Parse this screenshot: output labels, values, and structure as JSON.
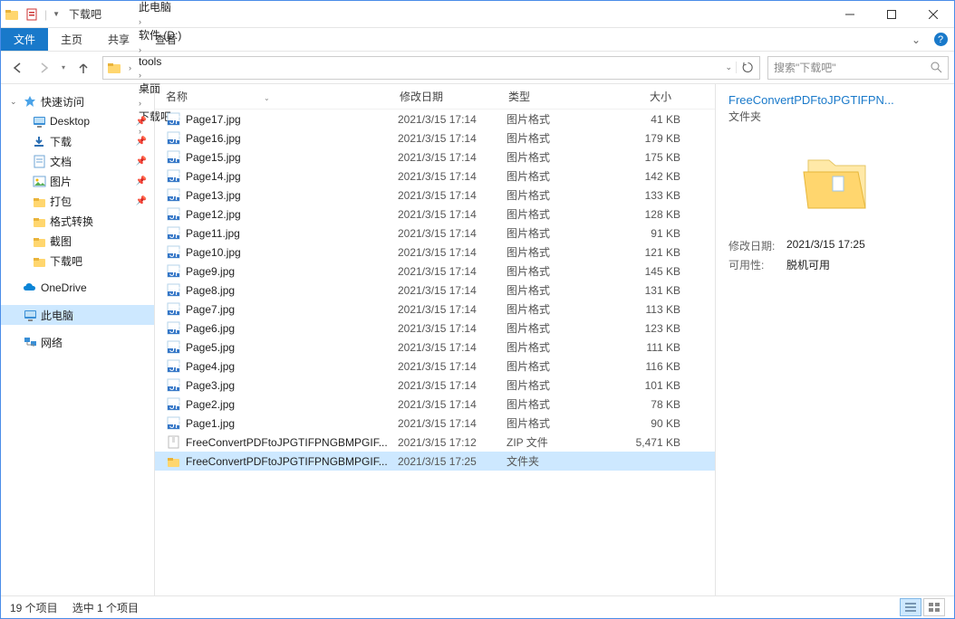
{
  "title": "下载吧",
  "ribbon": {
    "file": "文件",
    "tabs": [
      "主页",
      "共享",
      "查看"
    ]
  },
  "nav": {
    "path": [
      "此电脑",
      "软件 (D:)",
      "tools",
      "桌面",
      "下载吧"
    ],
    "search_placeholder": "搜索\"下载吧\""
  },
  "columns": {
    "name": "名称",
    "date": "修改日期",
    "type": "类型",
    "size": "大小"
  },
  "sidebar": {
    "quick": {
      "label": "快速访问",
      "items": [
        {
          "label": "Desktop",
          "icon": "desktop",
          "pin": true
        },
        {
          "label": "下载",
          "icon": "download",
          "pin": true
        },
        {
          "label": "文档",
          "icon": "document",
          "pin": true
        },
        {
          "label": "图片",
          "icon": "picture",
          "pin": true
        },
        {
          "label": "打包",
          "icon": "folder",
          "pin": true
        },
        {
          "label": "格式转换",
          "icon": "folder",
          "pin": false
        },
        {
          "label": "截图",
          "icon": "folder",
          "pin": false
        },
        {
          "label": "下载吧",
          "icon": "folder",
          "pin": false
        }
      ]
    },
    "onedrive": "OneDrive",
    "thispc": "此电脑",
    "network": "网络"
  },
  "files": [
    {
      "name": "Page17.jpg",
      "date": "2021/3/15 17:14",
      "type": "图片格式",
      "size": "41 KB",
      "icon": "jpg"
    },
    {
      "name": "Page16.jpg",
      "date": "2021/3/15 17:14",
      "type": "图片格式",
      "size": "179 KB",
      "icon": "jpg"
    },
    {
      "name": "Page15.jpg",
      "date": "2021/3/15 17:14",
      "type": "图片格式",
      "size": "175 KB",
      "icon": "jpg"
    },
    {
      "name": "Page14.jpg",
      "date": "2021/3/15 17:14",
      "type": "图片格式",
      "size": "142 KB",
      "icon": "jpg"
    },
    {
      "name": "Page13.jpg",
      "date": "2021/3/15 17:14",
      "type": "图片格式",
      "size": "133 KB",
      "icon": "jpg"
    },
    {
      "name": "Page12.jpg",
      "date": "2021/3/15 17:14",
      "type": "图片格式",
      "size": "128 KB",
      "icon": "jpg"
    },
    {
      "name": "Page11.jpg",
      "date": "2021/3/15 17:14",
      "type": "图片格式",
      "size": "91 KB",
      "icon": "jpg"
    },
    {
      "name": "Page10.jpg",
      "date": "2021/3/15 17:14",
      "type": "图片格式",
      "size": "121 KB",
      "icon": "jpg"
    },
    {
      "name": "Page9.jpg",
      "date": "2021/3/15 17:14",
      "type": "图片格式",
      "size": "145 KB",
      "icon": "jpg"
    },
    {
      "name": "Page8.jpg",
      "date": "2021/3/15 17:14",
      "type": "图片格式",
      "size": "131 KB",
      "icon": "jpg"
    },
    {
      "name": "Page7.jpg",
      "date": "2021/3/15 17:14",
      "type": "图片格式",
      "size": "113 KB",
      "icon": "jpg"
    },
    {
      "name": "Page6.jpg",
      "date": "2021/3/15 17:14",
      "type": "图片格式",
      "size": "123 KB",
      "icon": "jpg"
    },
    {
      "name": "Page5.jpg",
      "date": "2021/3/15 17:14",
      "type": "图片格式",
      "size": "111 KB",
      "icon": "jpg"
    },
    {
      "name": "Page4.jpg",
      "date": "2021/3/15 17:14",
      "type": "图片格式",
      "size": "116 KB",
      "icon": "jpg"
    },
    {
      "name": "Page3.jpg",
      "date": "2021/3/15 17:14",
      "type": "图片格式",
      "size": "101 KB",
      "icon": "jpg"
    },
    {
      "name": "Page2.jpg",
      "date": "2021/3/15 17:14",
      "type": "图片格式",
      "size": "78 KB",
      "icon": "jpg"
    },
    {
      "name": "Page1.jpg",
      "date": "2021/3/15 17:14",
      "type": "图片格式",
      "size": "90 KB",
      "icon": "jpg"
    },
    {
      "name": "FreeConvertPDFtoJPGTIFPNGBMPGIF...",
      "date": "2021/3/15 17:12",
      "type": "ZIP 文件",
      "size": "5,471 KB",
      "icon": "zip"
    },
    {
      "name": "FreeConvertPDFtoJPGTIFPNGBMPGIF...",
      "date": "2021/3/15 17:25",
      "type": "文件夹",
      "size": "",
      "icon": "folder",
      "selected": true
    }
  ],
  "details": {
    "title": "FreeConvertPDFtoJPGTIFPN...",
    "type": "文件夹",
    "rows": [
      {
        "k": "修改日期:",
        "v": "2021/3/15 17:25"
      },
      {
        "k": "可用性:",
        "v": "脱机可用"
      }
    ]
  },
  "status": {
    "count": "19 个项目",
    "selected": "选中 1 个项目"
  }
}
